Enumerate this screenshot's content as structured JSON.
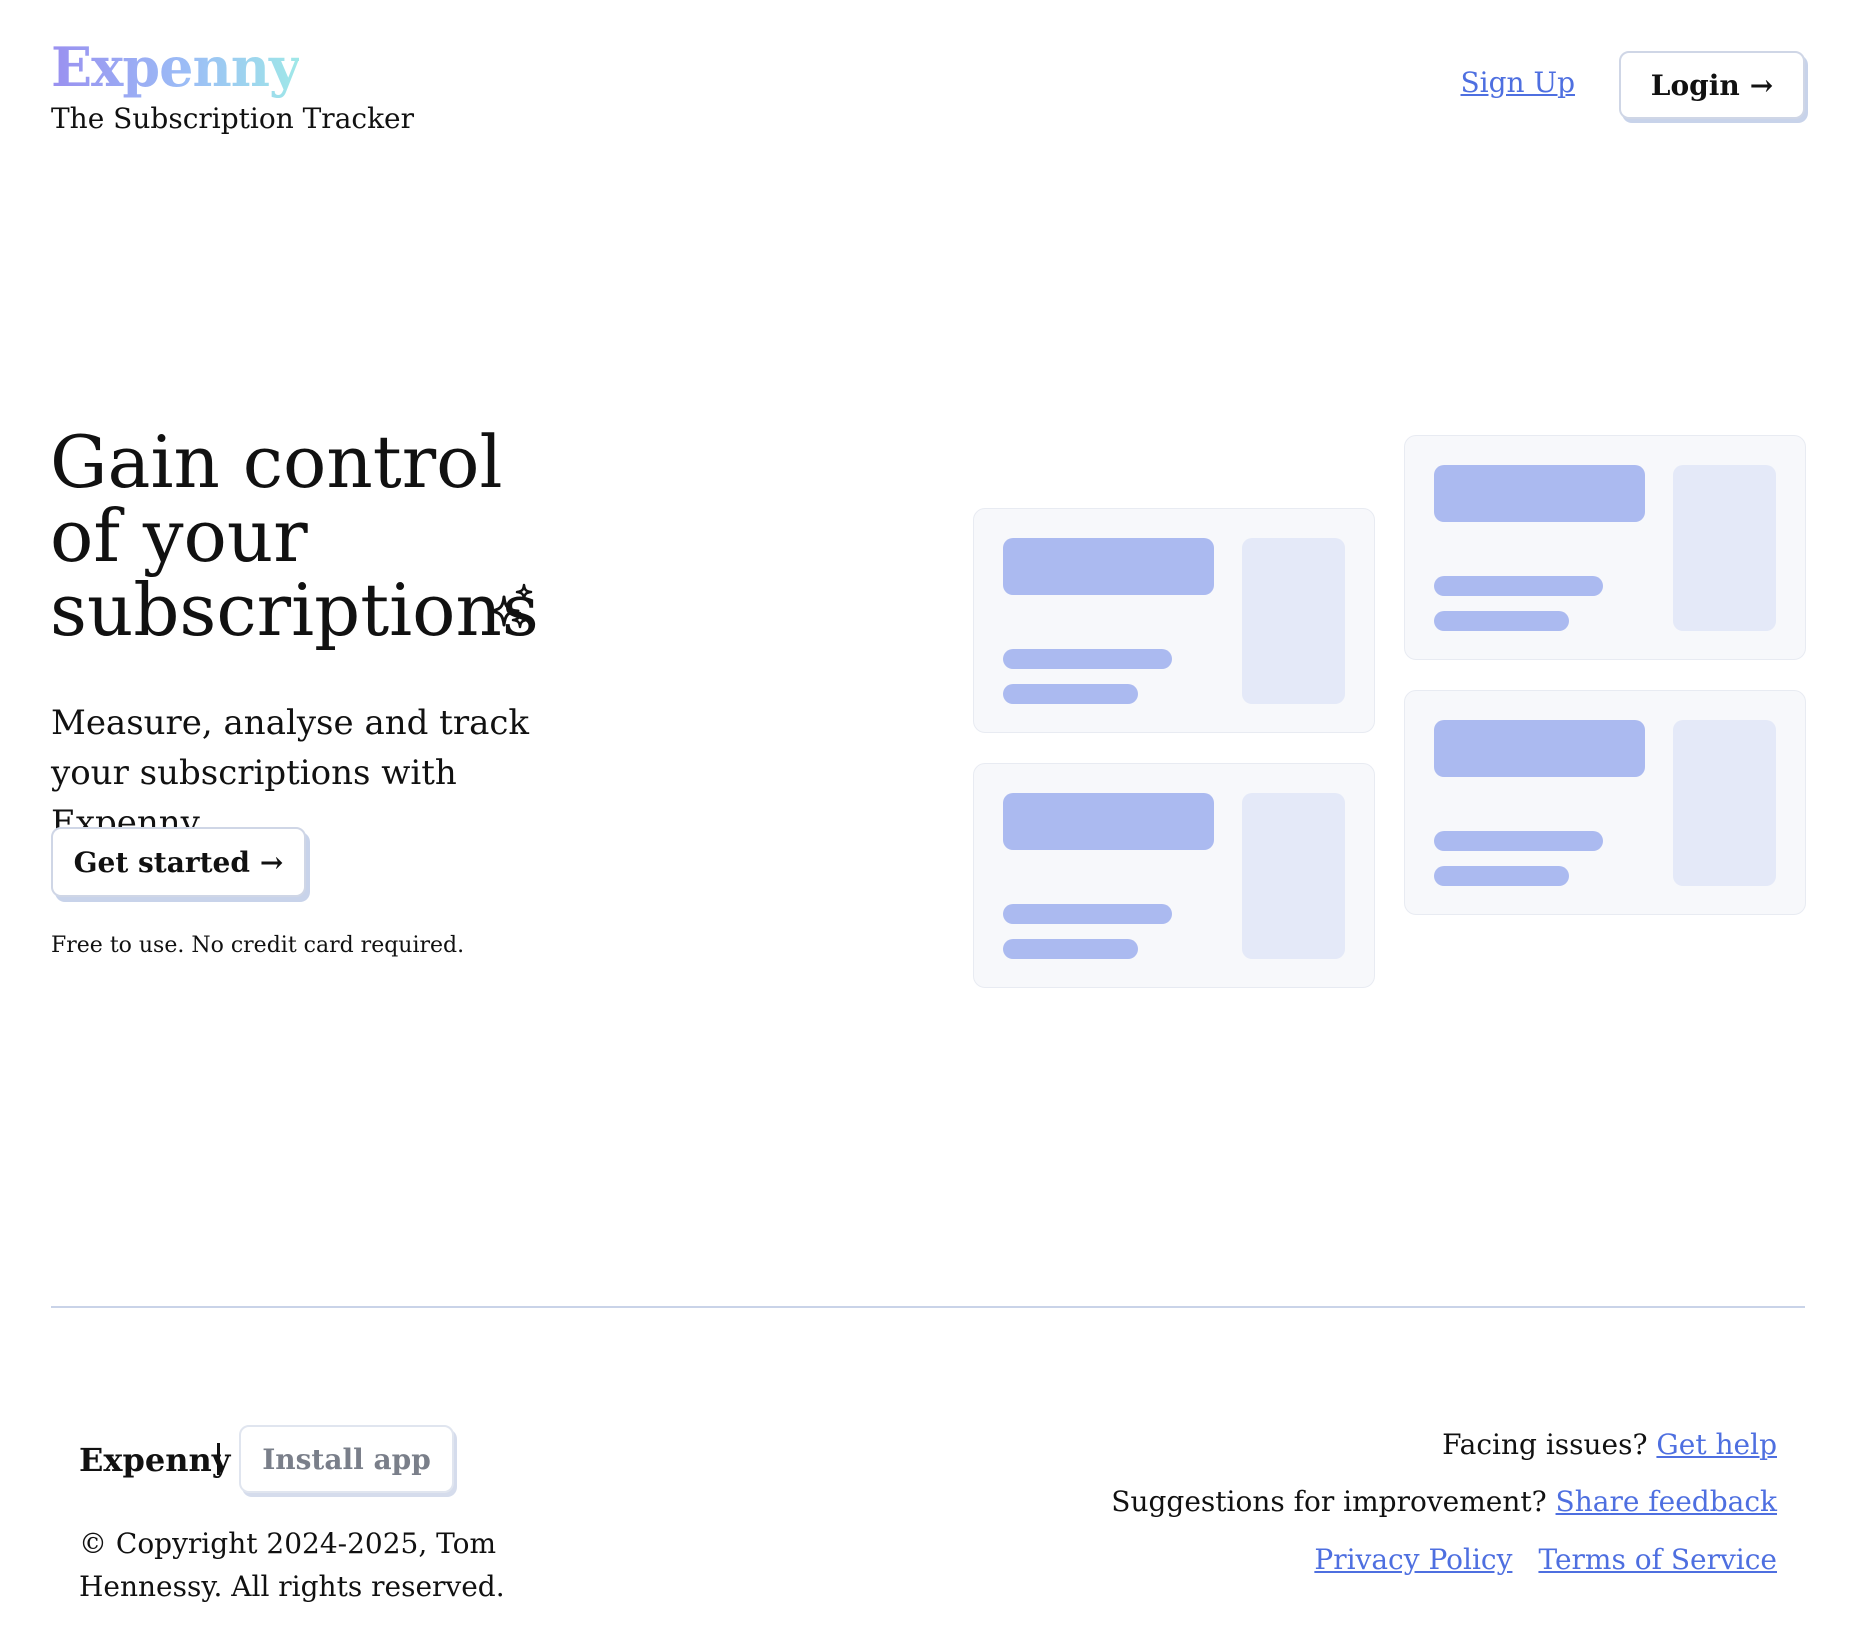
{
  "header": {
    "brand": "Expenny",
    "tagline": "The Subscription Tracker",
    "signup_label": "Sign Up",
    "login_label": "Login",
    "login_arrow": "→"
  },
  "hero": {
    "title_lines": [
      "Gain control",
      "of your",
      "subscriptions"
    ],
    "sparkle_icon": "sparkles-icon",
    "subtitle": "Measure, analyse and track your subscriptions with Expenny.",
    "cta_label": "Get started",
    "cta_arrow": "→",
    "note": "Free to use. No credit card required."
  },
  "illustration": {
    "card_count": 4,
    "colors": {
      "card_bg": "#f7f8fb",
      "accent": "#abbaf0",
      "side": "#e4e9f8"
    }
  },
  "footer": {
    "brand": "Expenny",
    "install_label": "Install app",
    "copyright": "© Copyright 2024-2025, Tom Hennessy. All rights reserved.",
    "help_prefix": "Facing issues?",
    "help_link": "Get help",
    "feedback_prefix": "Suggestions for improvement?",
    "feedback_link": "Share feedback",
    "privacy_link": "Privacy Policy",
    "terms_link": "Terms of Service"
  },
  "colors": {
    "link": "#4e6fe0",
    "text": "#111111",
    "divider": "#c9d3e8",
    "button_border": "#cfd6e6"
  }
}
